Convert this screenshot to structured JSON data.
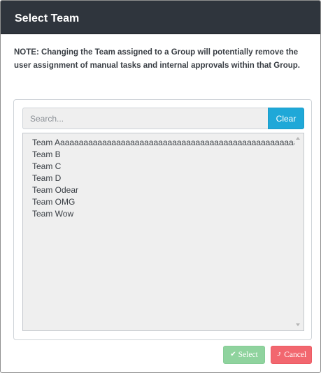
{
  "dialog": {
    "title": "Select Team",
    "note": "NOTE: Changing the Team assigned to a Group will potentially remove the user assignment of manual tasks and internal approvals within that Group."
  },
  "search": {
    "placeholder": "Search...",
    "value": "",
    "clear_label": "Clear"
  },
  "teams": [
    "Team Aaaaaaaaaaaaaaaaaaaaaaaaaaaaaaaaaaaaaaaaaaaaaaaaaaaaaaaaaaaaa",
    "Team B",
    "Team C",
    "Team D",
    "Team Odear",
    "Team OMG",
    "Team Wow"
  ],
  "footer": {
    "select_label": "Select",
    "cancel_label": "Cancel"
  },
  "icons": {
    "select": "check-icon",
    "cancel": "undo-icon"
  },
  "colors": {
    "header": "#2f353d",
    "clear_button": "#1fa8d8",
    "select_button": "#8fd39e",
    "cancel_button": "#f2676f",
    "list_background": "#efefef"
  }
}
